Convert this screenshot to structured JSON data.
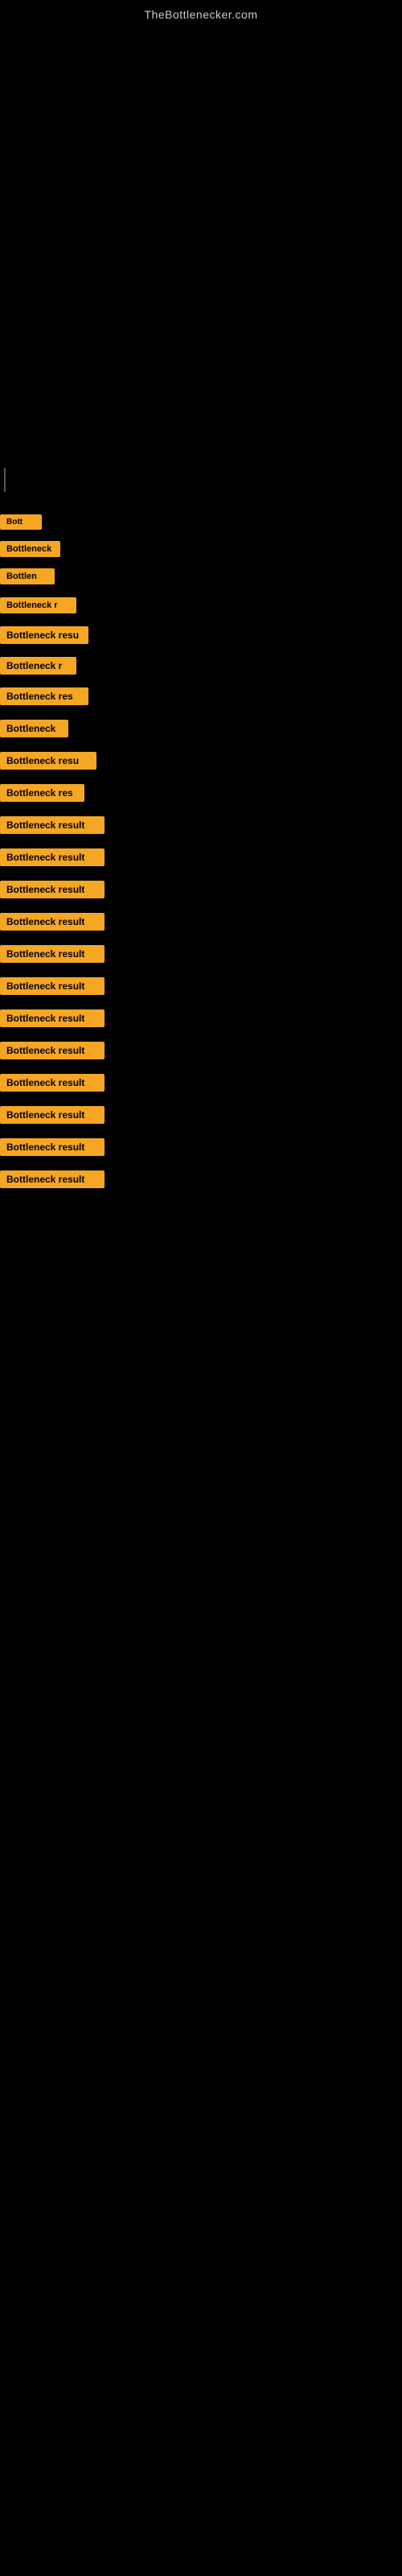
{
  "site": {
    "title": "TheBottlenecker.com"
  },
  "bottleneck_items": [
    {
      "id": 0,
      "label": "Bott"
    },
    {
      "id": 1,
      "label": "Bottleneck"
    },
    {
      "id": 2,
      "label": "Bottlen"
    },
    {
      "id": 3,
      "label": "Bottleneck r"
    },
    {
      "id": 4,
      "label": "Bottleneck resu"
    },
    {
      "id": 5,
      "label": "Bottleneck r"
    },
    {
      "id": 6,
      "label": "Bottleneck res"
    },
    {
      "id": 7,
      "label": "Bottleneck"
    },
    {
      "id": 8,
      "label": "Bottleneck resu"
    },
    {
      "id": 9,
      "label": "Bottleneck res"
    },
    {
      "id": 10,
      "label": "Bottleneck result"
    },
    {
      "id": 11,
      "label": "Bottleneck result"
    },
    {
      "id": 12,
      "label": "Bottleneck result"
    },
    {
      "id": 13,
      "label": "Bottleneck result"
    },
    {
      "id": 14,
      "label": "Bottleneck result"
    },
    {
      "id": 15,
      "label": "Bottleneck result"
    },
    {
      "id": 16,
      "label": "Bottleneck result"
    },
    {
      "id": 17,
      "label": "Bottleneck result"
    },
    {
      "id": 18,
      "label": "Bottleneck result"
    },
    {
      "id": 19,
      "label": "Bottleneck result"
    },
    {
      "id": 20,
      "label": "Bottleneck result"
    },
    {
      "id": 21,
      "label": "Bottleneck result"
    }
  ]
}
